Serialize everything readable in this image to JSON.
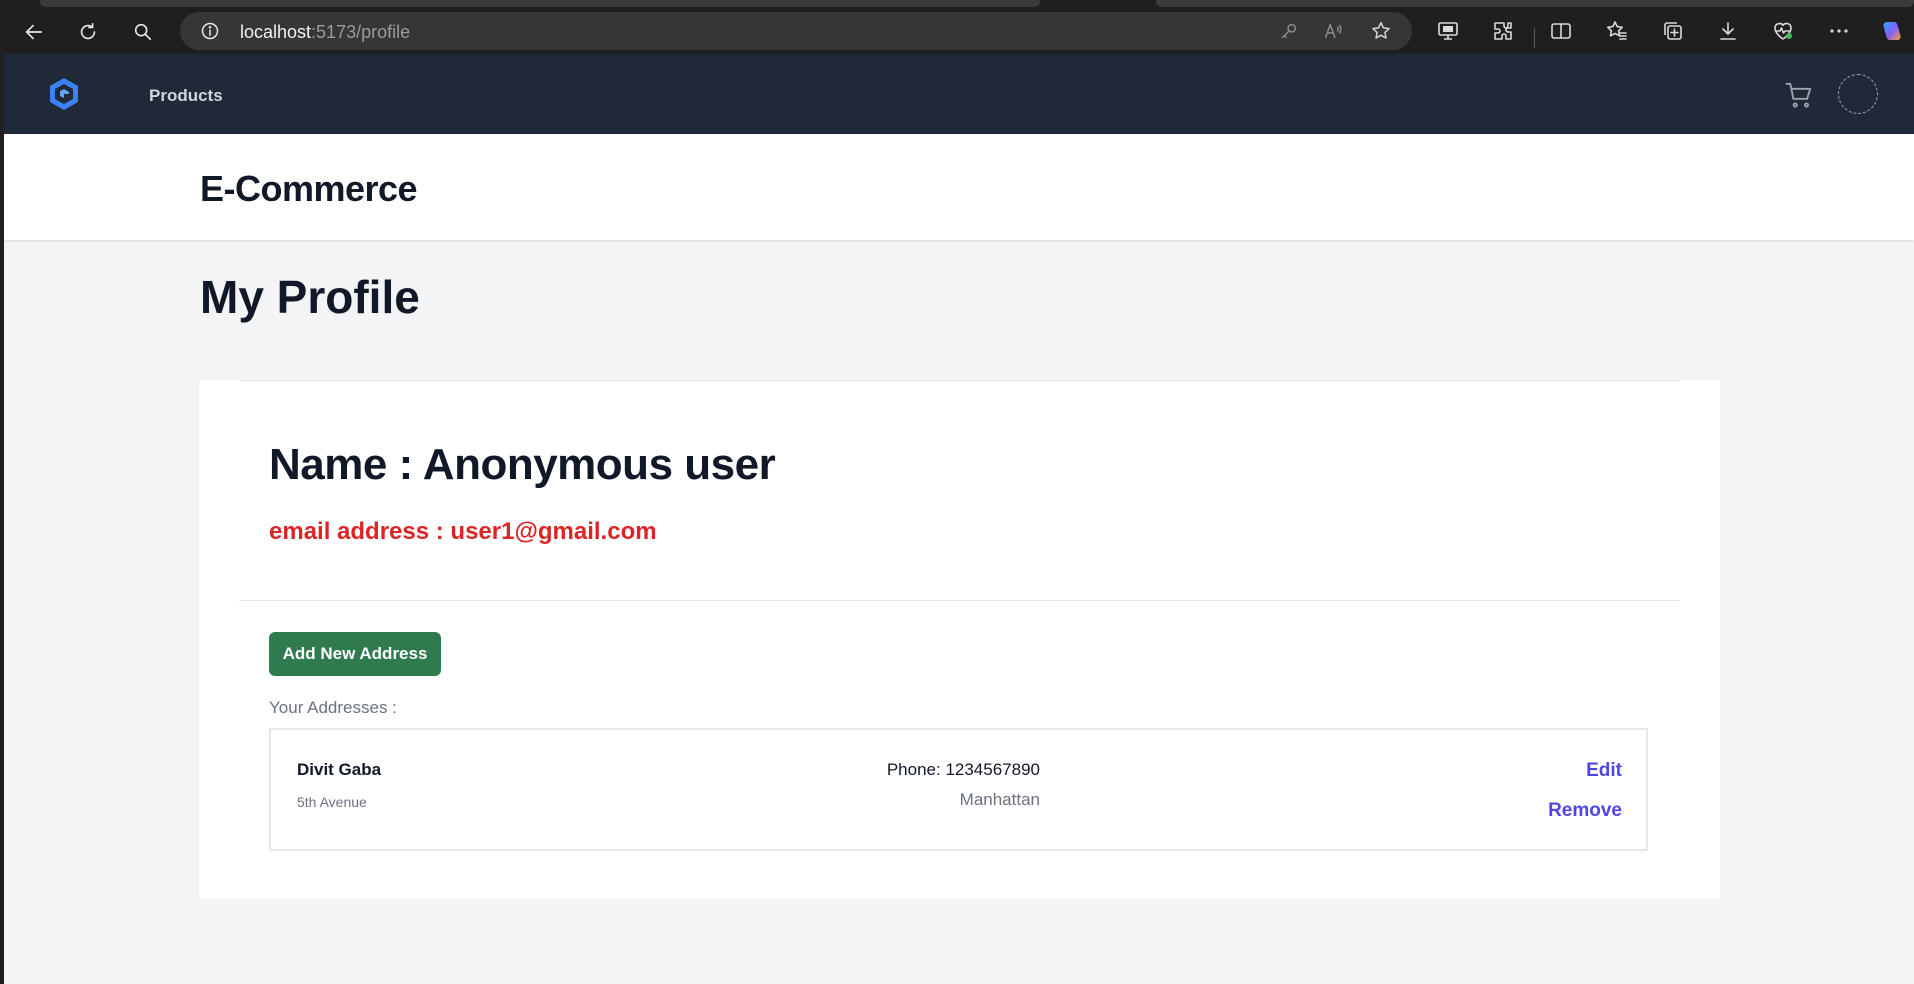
{
  "browser": {
    "url_host": "localhost",
    "url_path": ":5173/profile"
  },
  "app": {
    "nav": {
      "products_label": "Products"
    },
    "brand_title": "E-Commerce",
    "page_title": "My Profile"
  },
  "profile": {
    "name_line": "Name : Anonymous user",
    "email_line": "email address : user1@gmail.com",
    "add_address_label": "Add New Address",
    "addresses_heading": "Your Addresses :",
    "addresses": [
      {
        "name": "Divit Gaba",
        "street": "5th Avenue",
        "phone": "Phone: 1234567890",
        "city": "Manhattan",
        "edit_label": "Edit",
        "remove_label": "Remove"
      }
    ]
  },
  "colors": {
    "nav_bg": "#1f2937",
    "page_bg": "#f3f4f6",
    "email_red": "#dc2626",
    "button_green": "#2f7a4f",
    "link_indigo": "#4f46e5",
    "logo_blue": "#3b82f6"
  },
  "icons": [
    "back-icon",
    "refresh-icon",
    "search-icon",
    "site-info-icon",
    "key-icon",
    "read-aloud-icon",
    "favorite-star-icon",
    "screen-cast-icon",
    "extensions-icon",
    "split-screen-icon",
    "favorites-icon",
    "collections-icon",
    "download-icon",
    "browser-essentials-icon",
    "more-icon",
    "copilot-icon",
    "logo-icon",
    "cart-icon",
    "avatar"
  ]
}
